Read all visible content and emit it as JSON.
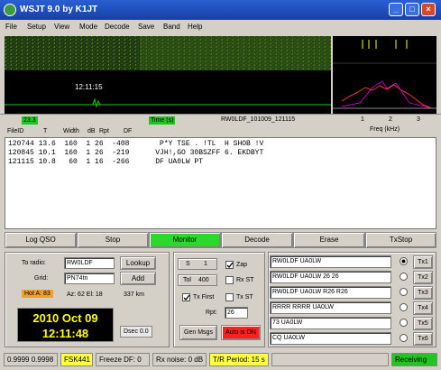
{
  "window": {
    "title": "WSJT 9.0     by K1JT",
    "minimize": "_",
    "maximize": "□",
    "close": "×"
  },
  "menu": [
    "File",
    "Setup",
    "View",
    "Mode",
    "Decode",
    "Save",
    "Band",
    "Help"
  ],
  "spectrum": {
    "time_label": "12:11:15"
  },
  "ruler": {
    "left_box": "23.3",
    "time_box": "Time (s)",
    "filename": "RW0LDF_101009_121115",
    "freq_ticks": [
      "1",
      "2",
      "3"
    ],
    "freq_label": "Freq (kHz)"
  },
  "decode_header": {
    "fileid": "FileID",
    "t": "T",
    "width": "Width",
    "db": "dB",
    "rpt": "Rpt",
    "df": "DF"
  },
  "decodes": [
    "120744 13.6  160  1 26  -408       P*Y TSE . !TL  H SHOB !V",
    "120845 10.1  160  1 26  -219      VJH!,GO 30BSZFF 6. EKDBYT",
    "121115 10.8   60  1 16  -266      DF UA0LW PT"
  ],
  "buttons": {
    "log_qso": "Log QSO",
    "stop": "Stop",
    "monitor": "Monitor",
    "decode": "Decode",
    "erase": "Erase",
    "txstop": "TxStop"
  },
  "station": {
    "to_radio_label": "To radio:",
    "to_radio": "RW0LDF",
    "lookup": "Lookup",
    "grid_label": "Grid:",
    "grid": "PN74tn",
    "add": "Add",
    "hot_a": "Hot A: 83",
    "az": "Az: 62  El: 18",
    "dist": "337 km"
  },
  "clock": {
    "date": "2010 Oct 09",
    "time": "12:11:48"
  },
  "dsec": "Dsec  0.0",
  "controls": {
    "s_label": "S",
    "s_value": "1",
    "tol_label": "Tol",
    "tol_value": "400",
    "zap": "Zap",
    "rxst": "Rx ST",
    "txfirst": "Tx First",
    "txst": "Tx ST",
    "rpt_label": "Rpt:",
    "rpt_value": "26",
    "gen_msgs": "Gen Msgs",
    "auto": "Auto is ON"
  },
  "tx_messages": [
    {
      "text": "RW0LDF UA0LW",
      "button": "Tx1",
      "selected": true
    },
    {
      "text": "RW0LDF UA0LW 26 26",
      "button": "Tx2",
      "selected": false
    },
    {
      "text": "RW0LDF UA0LW R26 R26",
      "button": "Tx3",
      "selected": false
    },
    {
      "text": "RRRR RRRR UA0LW",
      "button": "Tx4",
      "selected": false
    },
    {
      "text": "73 UA0LW",
      "button": "Tx5",
      "selected": false
    },
    {
      "text": "CQ UA0LW",
      "button": "Tx6",
      "selected": false
    }
  ],
  "status": {
    "levels": "0.9999 0.9998",
    "mode": "FSK441",
    "freeze": "Freeze DF:  0",
    "rxnoise": "Rx noise:  0 dB",
    "tr": "T/R Period: 15 s",
    "state": "Receiving"
  },
  "colors": {
    "monitor_on": "#2bd82b",
    "auto_on": "#ff2020",
    "clock_text": "#ffff00",
    "mode_bg": "#ffff44",
    "receiving_bg": "#22c422"
  }
}
